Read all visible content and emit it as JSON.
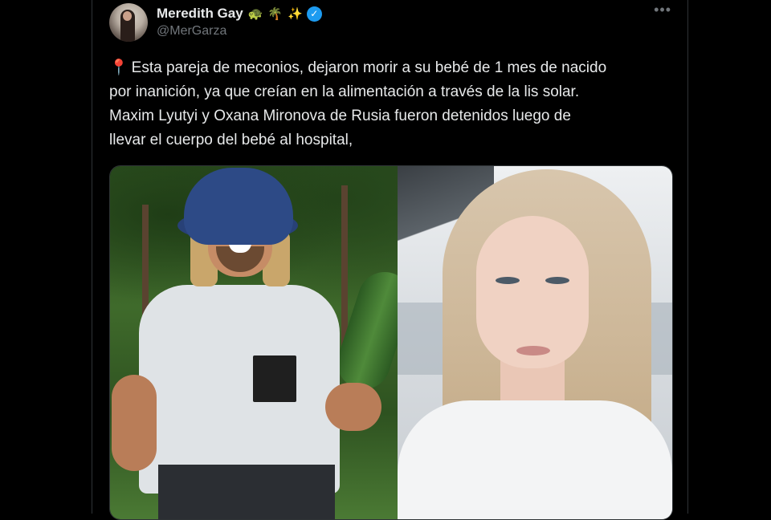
{
  "tweet": {
    "author": {
      "display_name": "Meredith Gay",
      "name_emojis": [
        "🐢",
        "🌴",
        "✨"
      ],
      "verified": true,
      "handle": "@MerGarza"
    },
    "more_menu_label": "•••",
    "pin_emoji": "📍",
    "text_lines": [
      "Esta pareja de meconios, dejaron morir a su bebé de 1 mes de nacido",
      "por inanición, ya que creían en la alimentación a través de la lis solar.",
      "Maxim Lyutyi y Oxana Mironova de Rusia fueron detenidos luego de",
      "llevar el cuerpo del bebé al hospital,"
    ],
    "media": {
      "count": 2
    }
  },
  "colors": {
    "background": "#000000",
    "text_primary": "#e7e9ea",
    "text_secondary": "#71767b",
    "verified_blue": "#1d9bf0",
    "border": "#2f3336"
  }
}
